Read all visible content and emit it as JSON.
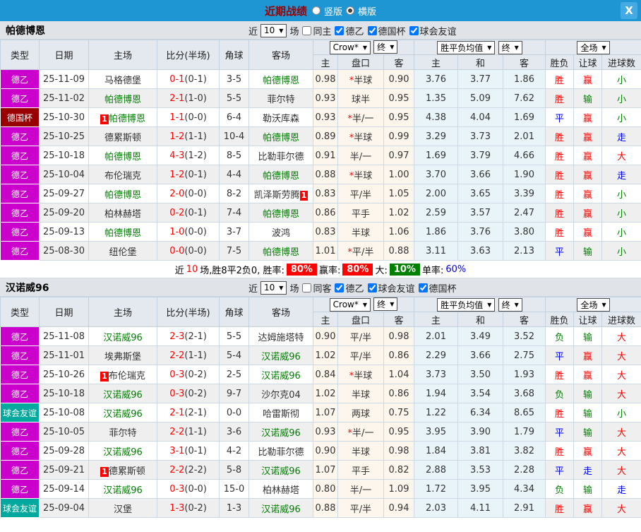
{
  "titlebar": {
    "title": "近期战绩",
    "radio_vertical_label": "竖版",
    "radio_horizontal_label": "横版",
    "vertical_selected": false,
    "horizontal_selected": true,
    "close_label": "X",
    "bar_color": "#1e96d4"
  },
  "table_header": {
    "base": [
      "类型",
      "日期",
      "主场",
      "比分(半场)",
      "角球",
      "客场"
    ],
    "sub": [
      "主",
      "盘口",
      "客",
      "主",
      "和",
      "客",
      "胜负",
      "让球",
      "进球数"
    ],
    "company_select": "Crow*",
    "final_select_1": "终",
    "avg_select": "胜平负均值",
    "final_select_2": "终",
    "fulltime_select": "全场"
  },
  "league_colors": {
    "德乙": "#cc00cc",
    "德国杯": "#990000",
    "球会友谊": "#00a99d"
  },
  "result_colors": {
    "胜": "#ff0000",
    "平": "#0000ee",
    "负": "#008000",
    "赢": "#ff0000",
    "输": "#008000",
    "走": "#0000ee",
    "大": "#ff0000",
    "小": "#008000"
  },
  "sections": [
    {
      "team": "帕德博恩",
      "filter": {
        "near": "近",
        "count": "10",
        "unit": "场",
        "checks": [
          {
            "label": "同主",
            "on": false
          },
          {
            "label": "德乙",
            "on": true
          },
          {
            "label": "德国杯",
            "on": true
          },
          {
            "label": "球会友谊",
            "on": true
          }
        ]
      },
      "rows": [
        {
          "lg": "德乙",
          "date": "25-11-09",
          "hb": "",
          "h": "马格德堡",
          "hg": false,
          "s": "0-1",
          "ht": "(0-1)",
          "c": "3-5",
          "a": "帕德博恩",
          "ag": true,
          "ab": "",
          "o1": "0.98",
          "hc": "*半球",
          "o2": "0.90",
          "w": "3.76",
          "d": "3.77",
          "l": "1.86",
          "r1": "胜",
          "r2": "赢",
          "r3": "小"
        },
        {
          "lg": "德乙",
          "date": "25-11-02",
          "hb": "",
          "h": "帕德博恩",
          "hg": true,
          "s": "2-1",
          "ht": "(1-0)",
          "c": "5-5",
          "a": "菲尔特",
          "ag": false,
          "ab": "",
          "o1": "0.93",
          "hc": "球半",
          "o2": "0.95",
          "w": "1.35",
          "d": "5.09",
          "l": "7.62",
          "r1": "胜",
          "r2": "输",
          "r3": "小"
        },
        {
          "lg": "德国杯",
          "date": "25-10-30",
          "hb": "1",
          "h": "帕德博恩",
          "hg": true,
          "s": "1-1",
          "ht": "(0-0)",
          "c": "6-4",
          "a": "勒沃库森",
          "ag": false,
          "ab": "",
          "o1": "0.93",
          "hc": "*半/一",
          "o2": "0.95",
          "w": "4.38",
          "d": "4.04",
          "l": "1.69",
          "r1": "平",
          "r2": "赢",
          "r3": "小"
        },
        {
          "lg": "德乙",
          "date": "25-10-25",
          "hb": "",
          "h": "德累斯顿",
          "hg": false,
          "s": "1-2",
          "ht": "(1-1)",
          "c": "10-4",
          "a": "帕德博恩",
          "ag": true,
          "ab": "",
          "o1": "0.89",
          "hc": "*半球",
          "o2": "0.99",
          "w": "3.29",
          "d": "3.73",
          "l": "2.01",
          "r1": "胜",
          "r2": "赢",
          "r3": "走"
        },
        {
          "lg": "德乙",
          "date": "25-10-18",
          "hb": "",
          "h": "帕德博恩",
          "hg": true,
          "s": "4-3",
          "ht": "(1-2)",
          "c": "8-5",
          "a": "比勒菲尔德",
          "ag": false,
          "ab": "",
          "o1": "0.91",
          "hc": "半/一",
          "o2": "0.97",
          "w": "1.69",
          "d": "3.79",
          "l": "4.66",
          "r1": "胜",
          "r2": "赢",
          "r3": "大"
        },
        {
          "lg": "德乙",
          "date": "25-10-04",
          "hb": "",
          "h": "布伦瑞克",
          "hg": false,
          "s": "1-2",
          "ht": "(0-1)",
          "c": "4-4",
          "a": "帕德博恩",
          "ag": true,
          "ab": "",
          "o1": "0.88",
          "hc": "*半球",
          "o2": "1.00",
          "w": "3.70",
          "d": "3.66",
          "l": "1.90",
          "r1": "胜",
          "r2": "赢",
          "r3": "走"
        },
        {
          "lg": "德乙",
          "date": "25-09-27",
          "hb": "",
          "h": "帕德博恩",
          "hg": true,
          "s": "2-0",
          "ht": "(0-0)",
          "c": "8-2",
          "a": "凯泽斯劳腾",
          "ag": false,
          "ab": "1",
          "o1": "0.83",
          "hc": "平/半",
          "o2": "1.05",
          "w": "2.00",
          "d": "3.65",
          "l": "3.39",
          "r1": "胜",
          "r2": "赢",
          "r3": "小"
        },
        {
          "lg": "德乙",
          "date": "25-09-20",
          "hb": "",
          "h": "柏林赫塔",
          "hg": false,
          "s": "0-2",
          "ht": "(0-1)",
          "c": "7-4",
          "a": "帕德博恩",
          "ag": true,
          "ab": "",
          "o1": "0.86",
          "hc": "平手",
          "o2": "1.02",
          "w": "2.59",
          "d": "3.57",
          "l": "2.47",
          "r1": "胜",
          "r2": "赢",
          "r3": "小"
        },
        {
          "lg": "德乙",
          "date": "25-09-13",
          "hb": "",
          "h": "帕德博恩",
          "hg": true,
          "s": "1-0",
          "ht": "(0-0)",
          "c": "3-7",
          "a": "波鸿",
          "ag": false,
          "ab": "",
          "o1": "0.83",
          "hc": "半球",
          "o2": "1.06",
          "w": "1.86",
          "d": "3.76",
          "l": "3.80",
          "r1": "胜",
          "r2": "赢",
          "r3": "小"
        },
        {
          "lg": "德乙",
          "date": "25-08-30",
          "hb": "",
          "h": "纽伦堡",
          "hg": false,
          "s": "0-0",
          "ht": "(0-0)",
          "c": "7-5",
          "a": "帕德博恩",
          "ag": true,
          "ab": "",
          "o1": "1.01",
          "hc": "*平/半",
          "o2": "0.88",
          "w": "3.11",
          "d": "3.63",
          "l": "2.13",
          "r1": "平",
          "r2": "输",
          "r3": "小"
        }
      ],
      "summary": {
        "near": "近",
        "count": "10",
        "record": "场,胜8平2负0, 胜率:",
        "win_rate": "80%",
        "profit_label": "赢率:",
        "profit_rate": "80%",
        "big_label": "大:",
        "big_rate": "10%",
        "single_label": "单率:",
        "single_rate": "60%"
      }
    },
    {
      "team": "汉诺威96",
      "filter": {
        "near": "近",
        "count": "10",
        "unit": "场",
        "checks": [
          {
            "label": "同客",
            "on": false
          },
          {
            "label": "德乙",
            "on": true
          },
          {
            "label": "球会友谊",
            "on": true
          },
          {
            "label": "德国杯",
            "on": true
          }
        ]
      },
      "rows": [
        {
          "lg": "德乙",
          "date": "25-11-08",
          "hb": "",
          "h": "汉诺威96",
          "hg": true,
          "s": "2-3",
          "ht": "(2-1)",
          "c": "5-5",
          "a": "达姆施塔特",
          "ag": false,
          "ab": "",
          "o1": "0.90",
          "hc": "平/半",
          "o2": "0.98",
          "w": "2.01",
          "d": "3.49",
          "l": "3.52",
          "r1": "负",
          "r2": "输",
          "r3": "大"
        },
        {
          "lg": "德乙",
          "date": "25-11-01",
          "hb": "",
          "h": "埃弗斯堡",
          "hg": false,
          "s": "2-2",
          "ht": "(1-1)",
          "c": "5-4",
          "a": "汉诺威96",
          "ag": true,
          "ab": "",
          "o1": "1.02",
          "hc": "平/半",
          "o2": "0.86",
          "w": "2.29",
          "d": "3.66",
          "l": "2.75",
          "r1": "平",
          "r2": "赢",
          "r3": "大"
        },
        {
          "lg": "德乙",
          "date": "25-10-26",
          "hb": "1",
          "h": "布伦瑞克",
          "hg": false,
          "s": "0-3",
          "ht": "(0-2)",
          "c": "2-5",
          "a": "汉诺威96",
          "ag": true,
          "ab": "",
          "o1": "0.84",
          "hc": "*半球",
          "o2": "1.04",
          "w": "3.73",
          "d": "3.50",
          "l": "1.93",
          "r1": "胜",
          "r2": "赢",
          "r3": "大"
        },
        {
          "lg": "德乙",
          "date": "25-10-18",
          "hb": "",
          "h": "汉诺威96",
          "hg": true,
          "s": "0-3",
          "ht": "(0-2)",
          "c": "9-7",
          "a": "沙尔克04",
          "ag": false,
          "ab": "",
          "o1": "1.02",
          "hc": "半球",
          "o2": "0.86",
          "w": "1.94",
          "d": "3.54",
          "l": "3.68",
          "r1": "负",
          "r2": "输",
          "r3": "大"
        },
        {
          "lg": "球会友谊",
          "date": "25-10-08",
          "hb": "",
          "h": "汉诺威96",
          "hg": true,
          "s": "2-1",
          "ht": "(2-1)",
          "c": "0-0",
          "a": "哈雷斯彻",
          "ag": false,
          "ab": "",
          "o1": "1.07",
          "hc": "两球",
          "o2": "0.75",
          "w": "1.22",
          "d": "6.34",
          "l": "8.65",
          "r1": "胜",
          "r2": "输",
          "r3": "小"
        },
        {
          "lg": "德乙",
          "date": "25-10-05",
          "hb": "",
          "h": "菲尔特",
          "hg": false,
          "s": "2-2",
          "ht": "(1-1)",
          "c": "3-6",
          "a": "汉诺威96",
          "ag": true,
          "ab": "",
          "o1": "0.93",
          "hc": "*半/一",
          "o2": "0.95",
          "w": "3.95",
          "d": "3.90",
          "l": "1.79",
          "r1": "平",
          "r2": "输",
          "r3": "大"
        },
        {
          "lg": "德乙",
          "date": "25-09-28",
          "hb": "",
          "h": "汉诺威96",
          "hg": true,
          "s": "3-1",
          "ht": "(0-1)",
          "c": "4-2",
          "a": "比勒菲尔德",
          "ag": false,
          "ab": "",
          "o1": "0.90",
          "hc": "半球",
          "o2": "0.98",
          "w": "1.84",
          "d": "3.81",
          "l": "3.82",
          "r1": "胜",
          "r2": "赢",
          "r3": "大"
        },
        {
          "lg": "德乙",
          "date": "25-09-21",
          "hb": "1",
          "h": "德累斯顿",
          "hg": false,
          "s": "2-2",
          "ht": "(2-2)",
          "c": "5-8",
          "a": "汉诺威96",
          "ag": true,
          "ab": "",
          "o1": "1.07",
          "hc": "平手",
          "o2": "0.82",
          "w": "2.88",
          "d": "3.53",
          "l": "2.28",
          "r1": "平",
          "r2": "走",
          "r3": "大"
        },
        {
          "lg": "德乙",
          "date": "25-09-14",
          "hb": "",
          "h": "汉诺威96",
          "hg": true,
          "s": "0-3",
          "ht": "(0-0)",
          "c": "15-0",
          "a": "柏林赫塔",
          "ag": false,
          "ab": "",
          "o1": "0.80",
          "hc": "半/一",
          "o2": "1.09",
          "w": "1.72",
          "d": "3.95",
          "l": "4.34",
          "r1": "负",
          "r2": "输",
          "r3": "走"
        },
        {
          "lg": "球会友谊",
          "date": "25-09-04",
          "hb": "",
          "h": "汉堡",
          "hg": false,
          "s": "1-3",
          "ht": "(0-2)",
          "c": "1-3",
          "a": "汉诺威96",
          "ag": true,
          "ab": "",
          "o1": "0.88",
          "hc": "平/半",
          "o2": "0.94",
          "w": "2.03",
          "d": "4.11",
          "l": "2.91",
          "r1": "胜",
          "r2": "赢",
          "r3": "大"
        }
      ],
      "summary": null
    }
  ]
}
